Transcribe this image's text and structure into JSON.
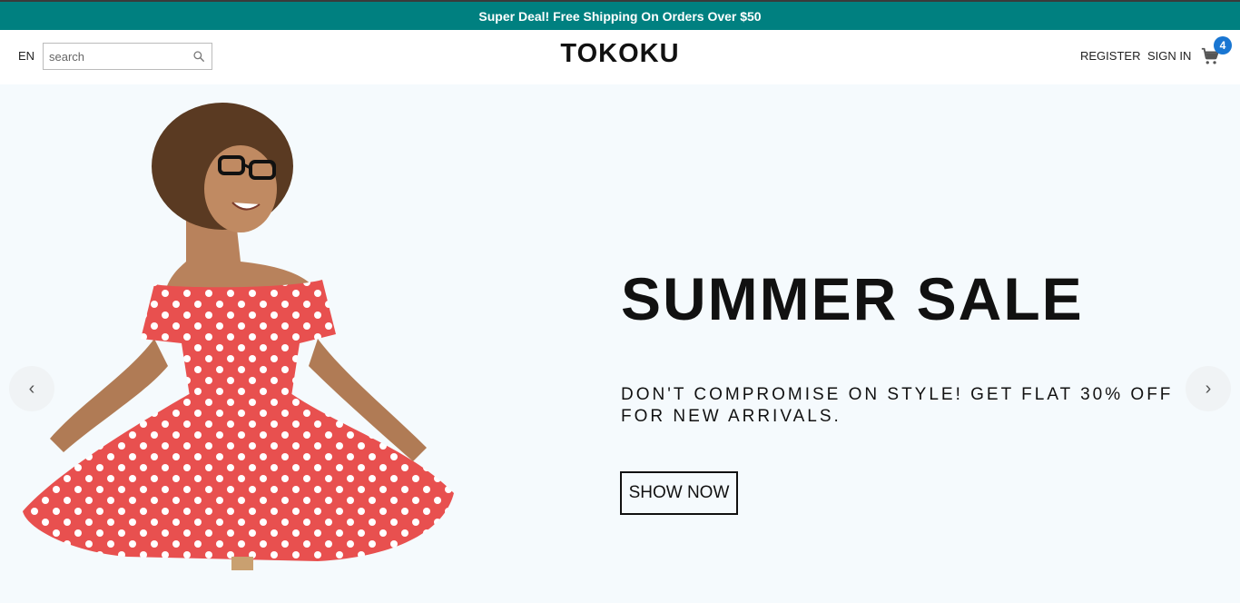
{
  "announcement": {
    "text": "Super Deal! Free Shipping On Orders Over $50"
  },
  "header": {
    "language": "EN",
    "search": {
      "placeholder": "search",
      "value": ""
    },
    "logo": "TOKOKU",
    "register_label": "REGISTER",
    "signin_label": "SIGN IN",
    "cart_count": "4"
  },
  "hero": {
    "title": "SUMMER SALE",
    "description": "DON'T COMPROMISE ON STYLE! GET FLAT 30% OFF FOR NEW ARRIVALS.",
    "cta_label": "SHOW NOW"
  },
  "colors": {
    "announcement_bg": "#008080",
    "hero_bg": "#f5fafd",
    "badge": "#1976d2",
    "dress": "#e8504f"
  }
}
